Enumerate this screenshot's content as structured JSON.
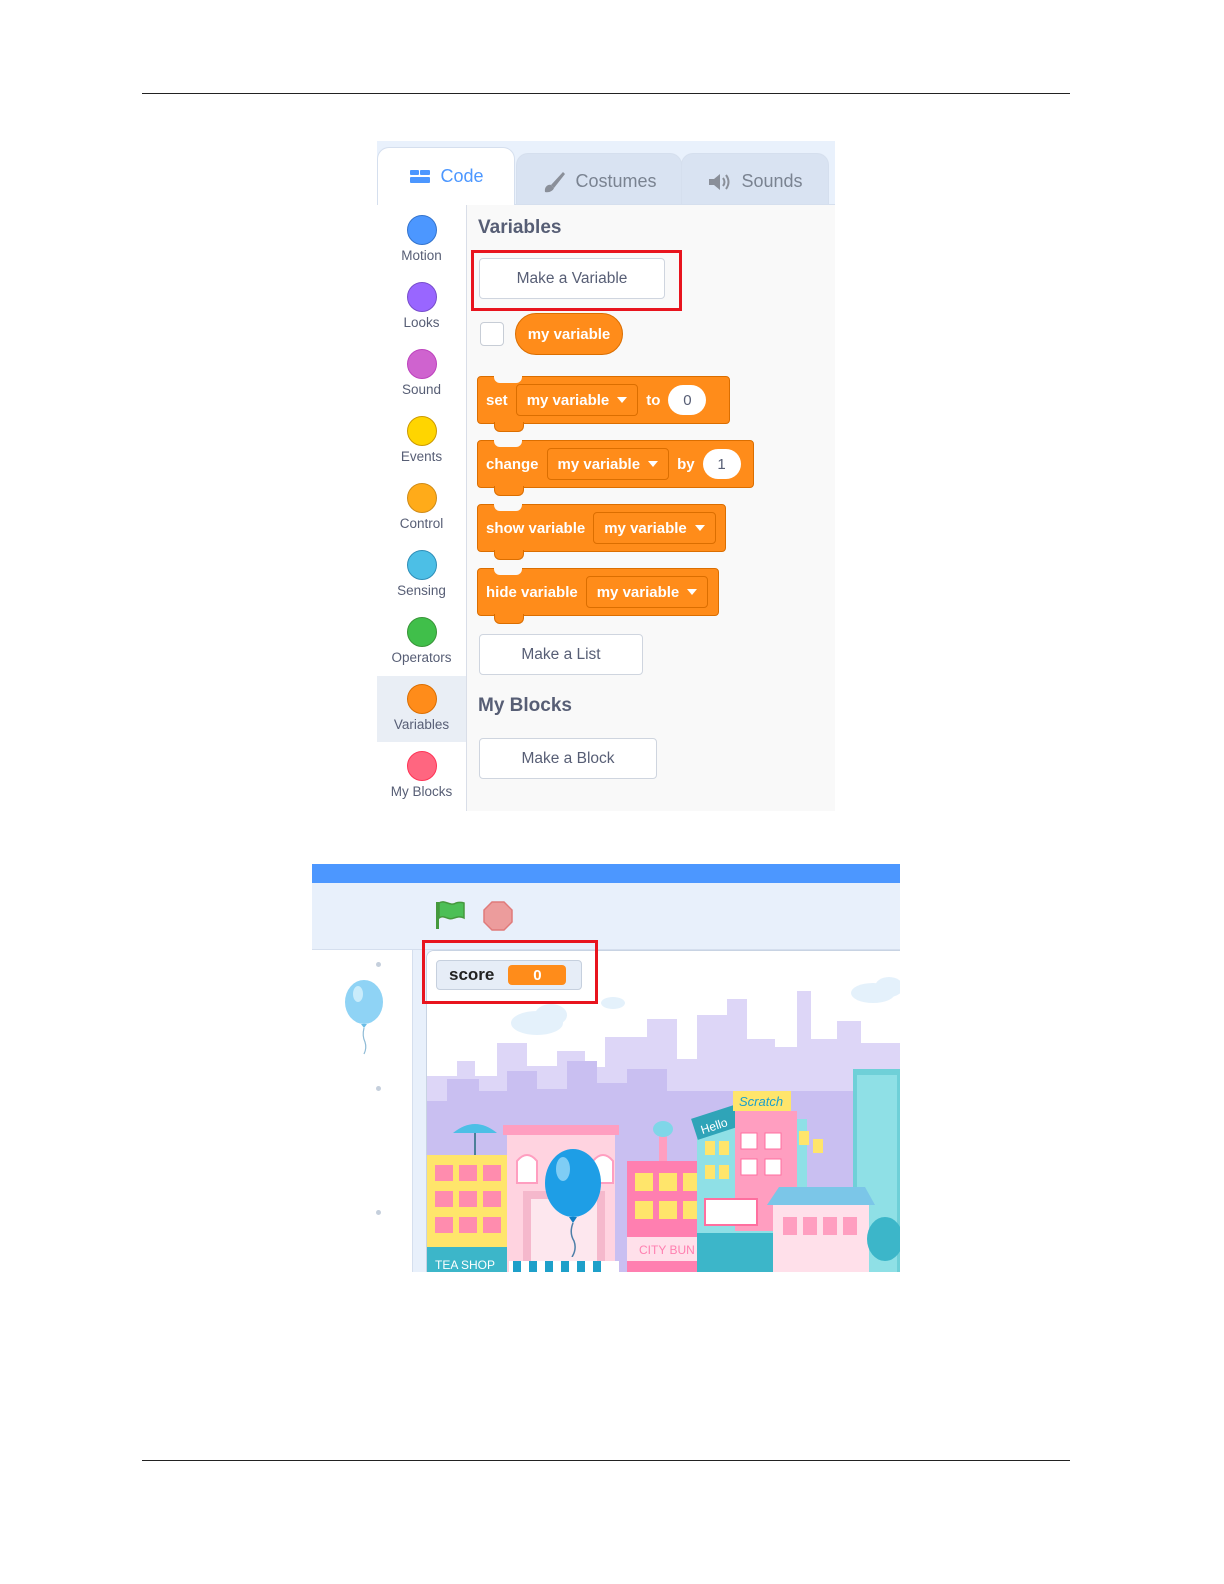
{
  "editor": {
    "tabs": [
      {
        "label": "Code",
        "icon": "code-icon",
        "active": true
      },
      {
        "label": "Costumes",
        "icon": "brush-icon",
        "active": false
      },
      {
        "label": "Sounds",
        "icon": "speaker-icon",
        "active": false
      }
    ],
    "categories": [
      {
        "label": "Motion",
        "color": "#4c97ff",
        "border": "#3373cc"
      },
      {
        "label": "Looks",
        "color": "#9966ff",
        "border": "#774dcb"
      },
      {
        "label": "Sound",
        "color": "#cf63cf",
        "border": "#bd42bd"
      },
      {
        "label": "Events",
        "color": "#ffd500",
        "border": "#cc9900"
      },
      {
        "label": "Control",
        "color": "#ffab19",
        "border": "#cf8b17"
      },
      {
        "label": "Sensing",
        "color": "#4cbfe6",
        "border": "#2e8eb8"
      },
      {
        "label": "Operators",
        "color": "#40bf4a",
        "border": "#389438"
      },
      {
        "label": "Variables",
        "color": "#ff8c1a",
        "border": "#db6e00",
        "selected": true
      },
      {
        "label": "My Blocks",
        "color": "#ff6680",
        "border": "#ff3355"
      }
    ],
    "palette": {
      "variables_title": "Variables",
      "make_variable": "Make a Variable",
      "variable_reporter": "my variable",
      "set_block": {
        "verb": "set",
        "variable": "my variable",
        "prep": "to",
        "value": "0"
      },
      "change_block": {
        "verb": "change",
        "variable": "my variable",
        "prep": "by",
        "value": "1"
      },
      "show_block": {
        "verb": "show variable",
        "variable": "my variable"
      },
      "hide_block": {
        "verb": "hide variable",
        "variable": "my variable"
      },
      "make_list": "Make a List",
      "my_blocks_title": "My Blocks",
      "make_block": "Make a Block"
    },
    "highlight_color": "#e8141e"
  },
  "stage": {
    "monitor": {
      "label": "score",
      "value": "0"
    },
    "signs": {
      "scratch": "Scratch",
      "hello": "Hello",
      "tea_shop": "TEA SHOP",
      "city_bun": "CITY BUN"
    },
    "accent": "#4c97ff"
  }
}
